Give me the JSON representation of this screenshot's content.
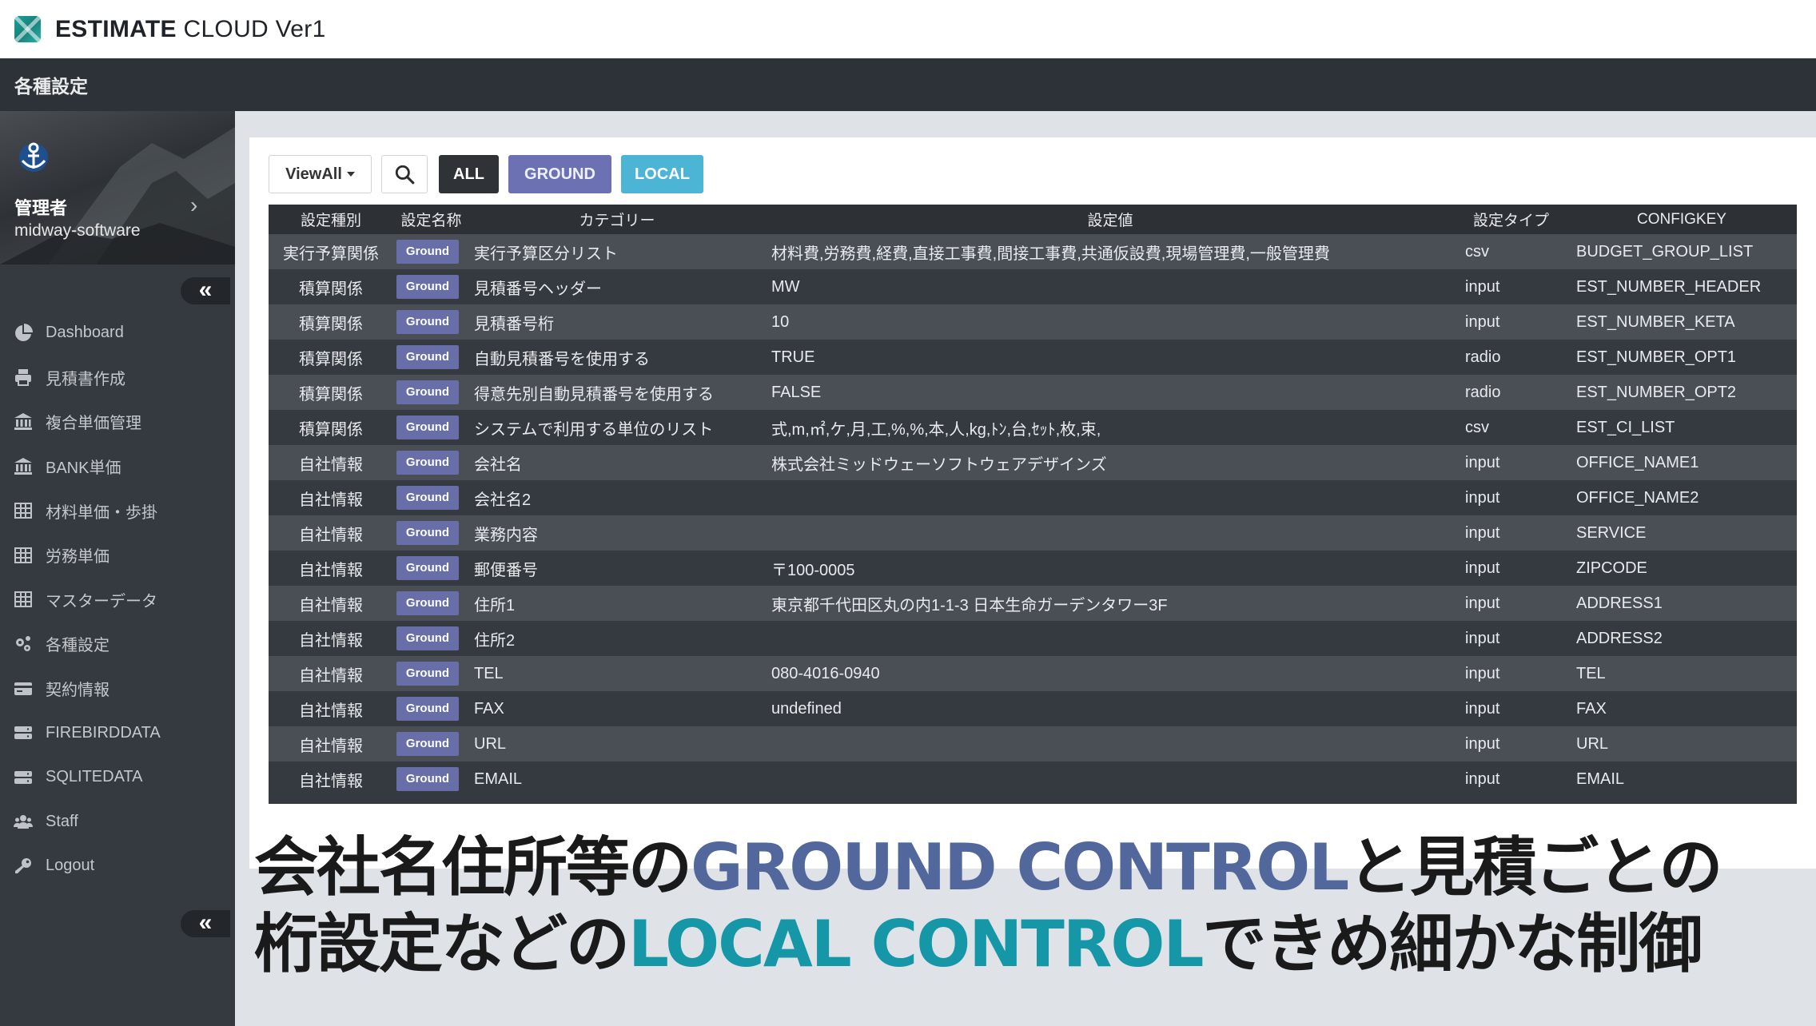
{
  "app": {
    "title_bold": "ESTIMATE",
    "title_rest": "CLOUD Ver1"
  },
  "header": {
    "title": "各種設定"
  },
  "user": {
    "name": "管理者",
    "org": "midway-software"
  },
  "sidebar": {
    "collapse_label": "«",
    "items": [
      {
        "label": "Dashboard",
        "icon": "pie-chart-icon"
      },
      {
        "label": "見積書作成",
        "icon": "print-icon"
      },
      {
        "label": "複合単価管理",
        "icon": "bank-icon"
      },
      {
        "label": "BANK単価",
        "icon": "bank-icon"
      },
      {
        "label": "材料単価・歩掛",
        "icon": "grid-icon"
      },
      {
        "label": "労務単価",
        "icon": "grid-icon"
      },
      {
        "label": "マスターデータ",
        "icon": "grid-icon"
      },
      {
        "label": "各種設定",
        "icon": "gears-icon"
      },
      {
        "label": "契約情報",
        "icon": "credit-card-icon"
      },
      {
        "label": "FIREBIRDDATA",
        "icon": "server-icon"
      },
      {
        "label": "SQLITEDATA",
        "icon": "server-icon"
      },
      {
        "label": "Staff",
        "icon": "users-icon"
      },
      {
        "label": "Logout",
        "icon": "key-icon"
      }
    ]
  },
  "toolbar": {
    "view_label": "ViewAll",
    "all_label": "ALL",
    "ground_label": "GROUND",
    "local_label": "LOCAL"
  },
  "table": {
    "headers": [
      "設定種別",
      "設定名称",
      "カテゴリー",
      "設定値",
      "設定タイプ",
      "CONFIGKEY"
    ],
    "rows": [
      {
        "type": "実行予算関係",
        "badge": "Ground",
        "category": "実行予算区分リスト",
        "value": "材料費,労務費,経費,直接工事費,間接工事費,共通仮設費,現場管理費,一般管理費",
        "stype": "csv",
        "key": "BUDGET_GROUP_LIST"
      },
      {
        "type": "積算関係",
        "badge": "Ground",
        "category": "見積番号ヘッダー",
        "value": "MW",
        "stype": "input",
        "key": "EST_NUMBER_HEADER"
      },
      {
        "type": "積算関係",
        "badge": "Ground",
        "category": "見積番号桁",
        "value": "10",
        "stype": "input",
        "key": "EST_NUMBER_KETA"
      },
      {
        "type": "積算関係",
        "badge": "Ground",
        "category": "自動見積番号を使用する",
        "value": "TRUE",
        "stype": "radio",
        "key": "EST_NUMBER_OPT1"
      },
      {
        "type": "積算関係",
        "badge": "Ground",
        "category": "得意先別自動見積番号を使用する",
        "value": "FALSE",
        "stype": "radio",
        "key": "EST_NUMBER_OPT2"
      },
      {
        "type": "積算関係",
        "badge": "Ground",
        "category": "システムで利用する単位のリスト",
        "value": "式,m,㎡,ケ,月,工,%,%,本,人,kg,ﾄﾝ,台,ｾｯﾄ,枚,束,",
        "stype": "csv",
        "key": "EST_CI_LIST"
      },
      {
        "type": "自社情報",
        "badge": "Ground",
        "category": "会社名",
        "value": "株式会社ミッドウェーソフトウェアデザインズ",
        "stype": "input",
        "key": "OFFICE_NAME1"
      },
      {
        "type": "自社情報",
        "badge": "Ground",
        "category": "会社名2",
        "value": "",
        "stype": "input",
        "key": "OFFICE_NAME2"
      },
      {
        "type": "自社情報",
        "badge": "Ground",
        "category": "業務内容",
        "value": "",
        "stype": "input",
        "key": "SERVICE"
      },
      {
        "type": "自社情報",
        "badge": "Ground",
        "category": "郵便番号",
        "value": "〒100-0005",
        "stype": "input",
        "key": "ZIPCODE"
      },
      {
        "type": "自社情報",
        "badge": "Ground",
        "category": "住所1",
        "value": "東京都千代田区丸の内1-1-3 日本生命ガーデンタワー3F",
        "stype": "input",
        "key": "ADDRESS1"
      },
      {
        "type": "自社情報",
        "badge": "Ground",
        "category": "住所2",
        "value": "",
        "stype": "input",
        "key": "ADDRESS2"
      },
      {
        "type": "自社情報",
        "badge": "Ground",
        "category": "TEL",
        "value": "080-4016-0940",
        "stype": "input",
        "key": "TEL"
      },
      {
        "type": "自社情報",
        "badge": "Ground",
        "category": "FAX",
        "value": "undefined",
        "stype": "input",
        "key": "FAX"
      },
      {
        "type": "自社情報",
        "badge": "Ground",
        "category": "URL",
        "value": "",
        "stype": "input",
        "key": "URL"
      },
      {
        "type": "自社情報",
        "badge": "Ground",
        "category": "EMAIL",
        "value": "",
        "stype": "input",
        "key": "EMAIL"
      }
    ]
  },
  "caption": {
    "line1_a": "会社名住所等の",
    "line1_hl": "GROUND CONTROL",
    "line1_b": "と見積ごとの",
    "line2_a": "桁設定などの",
    "line2_hl": "LOCAL CONTROL",
    "line2_b": "できめ細かな制御"
  },
  "colors": {
    "ground": "#676ea8",
    "local": "#4cb5d6",
    "caption_ground": "#52689d",
    "caption_local": "#1597a8"
  }
}
